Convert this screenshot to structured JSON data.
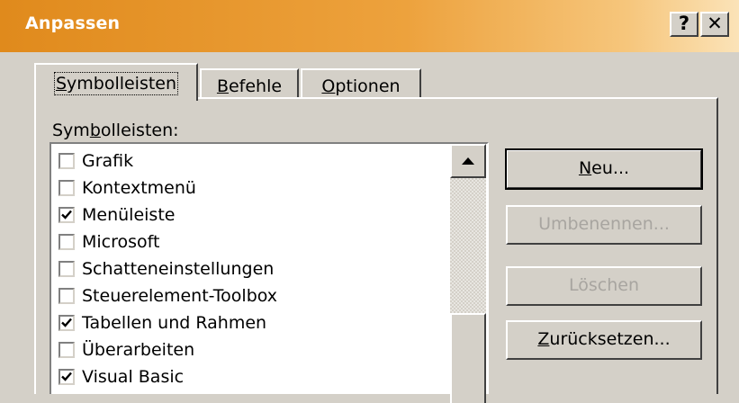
{
  "window": {
    "title": "Anpassen",
    "help_label": "?",
    "close_label": "✕"
  },
  "tabs": [
    {
      "mnemonic": "S",
      "rest": "ymbolleisten",
      "active": true
    },
    {
      "mnemonic": "B",
      "rest": "efehle",
      "active": false
    },
    {
      "mnemonic": "O",
      "rest": "ptionen",
      "active": false
    }
  ],
  "list": {
    "label_pre": "Sym",
    "label_mnemonic": "b",
    "label_post": "olleisten:",
    "items": [
      {
        "label": "Grafik",
        "checked": false
      },
      {
        "label": "Kontextmenü",
        "checked": false
      },
      {
        "label": "Menüleiste",
        "checked": true
      },
      {
        "label": "Microsoft",
        "checked": false
      },
      {
        "label": "Schatteneinstellungen",
        "checked": false
      },
      {
        "label": "Steuerelement-Toolbox",
        "checked": false
      },
      {
        "label": "Tabellen und Rahmen",
        "checked": true
      },
      {
        "label": "Überarbeiten",
        "checked": false
      },
      {
        "label": "Visual Basic",
        "checked": true
      }
    ]
  },
  "buttons": {
    "new": {
      "mnemonic": "N",
      "rest": "eu...",
      "enabled": true
    },
    "rename": {
      "label": "Umbenennen...",
      "enabled": false
    },
    "delete": {
      "label": "Löschen",
      "enabled": false
    },
    "reset": {
      "mnemonic": "Z",
      "rest": "urücksetzen...",
      "enabled": true
    }
  }
}
